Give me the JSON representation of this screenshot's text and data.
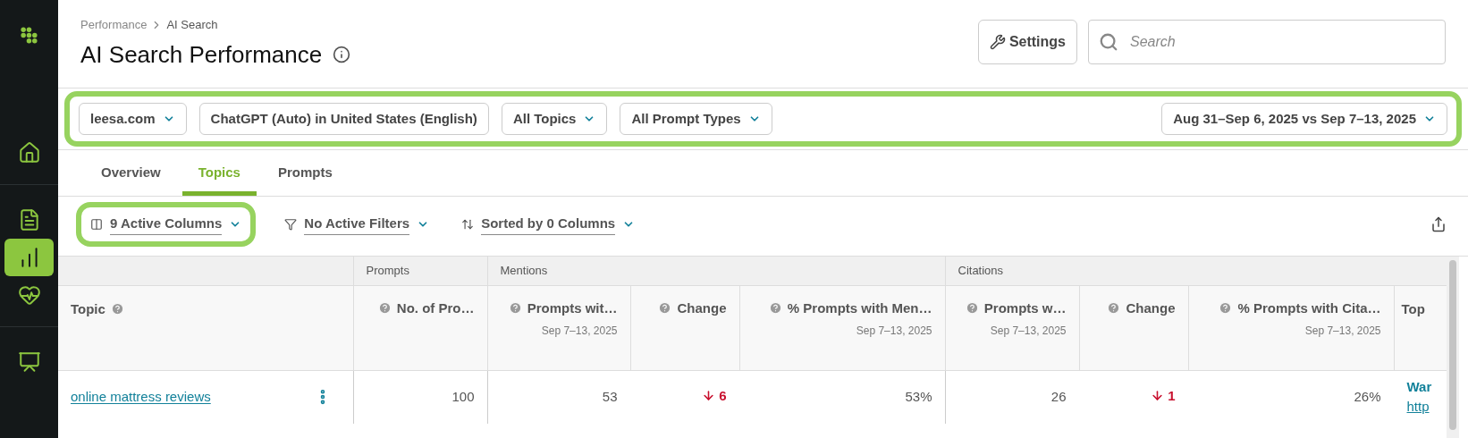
{
  "sidebar": {
    "items": [
      {
        "kind": "home",
        "selected": false
      },
      {
        "kind": "report",
        "selected": false
      },
      {
        "kind": "performance",
        "selected": true
      },
      {
        "kind": "health",
        "selected": false
      },
      {
        "kind": "presentation",
        "selected": false
      }
    ]
  },
  "breadcrumb": [
    "Performance",
    "AI Search"
  ],
  "title": "AI Search Performance",
  "settings_button": "Settings",
  "search": {
    "placeholder": "Search"
  },
  "filters": [
    {
      "label": "leesa.com",
      "dropdown": true
    },
    {
      "label": "ChatGPT (Auto) in United States (English)",
      "dropdown": false
    },
    {
      "label": "All Topics",
      "dropdown": true
    },
    {
      "label": "All Prompt Types",
      "dropdown": true
    }
  ],
  "date_range": "Aug 31–Sep 6, 2025 vs Sep 7–13, 2025",
  "tabs": [
    {
      "label": "Overview",
      "selected": false
    },
    {
      "label": "Topics",
      "selected": true
    },
    {
      "label": "Prompts",
      "selected": false
    }
  ],
  "toolbar": [
    {
      "kind": "columns",
      "label": "9 Active Columns"
    },
    {
      "kind": "filters",
      "label": "No Active Filters"
    },
    {
      "kind": "sort",
      "label": "Sorted by 0 Columns"
    }
  ],
  "table": {
    "groups": [
      {
        "columns": [
          {
            "label": "Topic",
            "help": true
          }
        ]
      },
      {
        "label": "Prompts",
        "columns": [
          {
            "label": "No. of Pro…",
            "help": true
          }
        ]
      },
      {
        "label": "Mentions",
        "columns": [
          {
            "label": "Prompts wit…",
            "help": true,
            "date": "Sep 7–13, 2025"
          },
          {
            "label": "Change",
            "help": true
          },
          {
            "label": "% Prompts with Men…",
            "help": true,
            "date": "Sep 7–13, 2025"
          }
        ]
      },
      {
        "label": "Citations",
        "columns": [
          {
            "label": "Prompts w…",
            "help": true,
            "date": "Sep 7–13, 2025"
          },
          {
            "label": "Change",
            "help": true
          },
          {
            "label": "% Prompts with Cita…",
            "help": true,
            "date": "Sep 7–13, 2025"
          },
          {
            "label": "Top",
            "help": false
          }
        ]
      }
    ],
    "rows": [
      {
        "cells": [
          {
            "kind": "topic",
            "text": "online mattress reviews"
          },
          {
            "kind": "number",
            "text": "100"
          },
          {
            "kind": "number",
            "text": "53"
          },
          {
            "kind": "decrease",
            "text": "6"
          },
          {
            "kind": "number",
            "text": "53%"
          },
          {
            "kind": "number",
            "text": "26"
          },
          {
            "kind": "decrease",
            "text": "1"
          },
          {
            "kind": "number",
            "text": "26%"
          },
          {
            "kind": "link",
            "title": "War",
            "url": "http"
          }
        ]
      }
    ]
  }
}
